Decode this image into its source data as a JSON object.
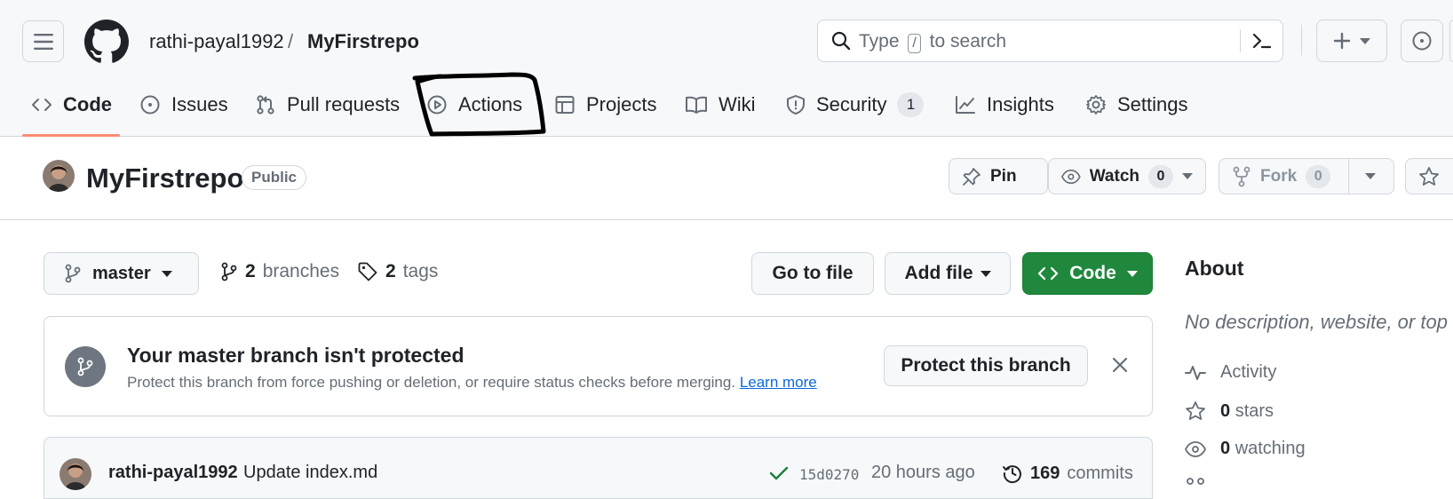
{
  "header": {
    "owner": "rathi-payal1992",
    "separator": "/",
    "repo": "MyFirstrepo",
    "search": {
      "prefix": "Type",
      "key": "/",
      "suffix": "to search"
    }
  },
  "tabs": [
    {
      "label": "Code"
    },
    {
      "label": "Issues"
    },
    {
      "label": "Pull requests"
    },
    {
      "label": "Actions"
    },
    {
      "label": "Projects"
    },
    {
      "label": "Wiki"
    },
    {
      "label": "Security",
      "count": "1"
    },
    {
      "label": "Insights"
    },
    {
      "label": "Settings"
    }
  ],
  "repo_header": {
    "title": "MyFirstrepo",
    "visibility": "Public",
    "pin_label": "Pin",
    "watch_label": "Watch",
    "watch_count": "0",
    "fork_label": "Fork",
    "fork_count": "0"
  },
  "toolbar": {
    "branch": "master",
    "branches_count": "2",
    "branches_label": "branches",
    "tags_count": "2",
    "tags_label": "tags",
    "goto_file": "Go to file",
    "add_file": "Add file",
    "code": "Code"
  },
  "banner": {
    "title": "Your master branch isn't protected",
    "description": "Protect this branch from force pushing or deletion, or require status checks before merging.",
    "link": "Learn more",
    "button": "Protect this branch"
  },
  "commit": {
    "author": "rathi-payal1992",
    "message": "Update index.md",
    "sha": "15d0270",
    "time": "20 hours ago",
    "count": "169",
    "count_label": "commits"
  },
  "about": {
    "title": "About",
    "description": "No description, website, or top",
    "activity": "Activity",
    "stars_count": "0",
    "stars_label": "stars",
    "watching_count": "0",
    "watching_label": "watching"
  },
  "colors": {
    "accent_green": "#1f883d",
    "tab_underline": "#fd8c73",
    "link": "#0969da"
  }
}
